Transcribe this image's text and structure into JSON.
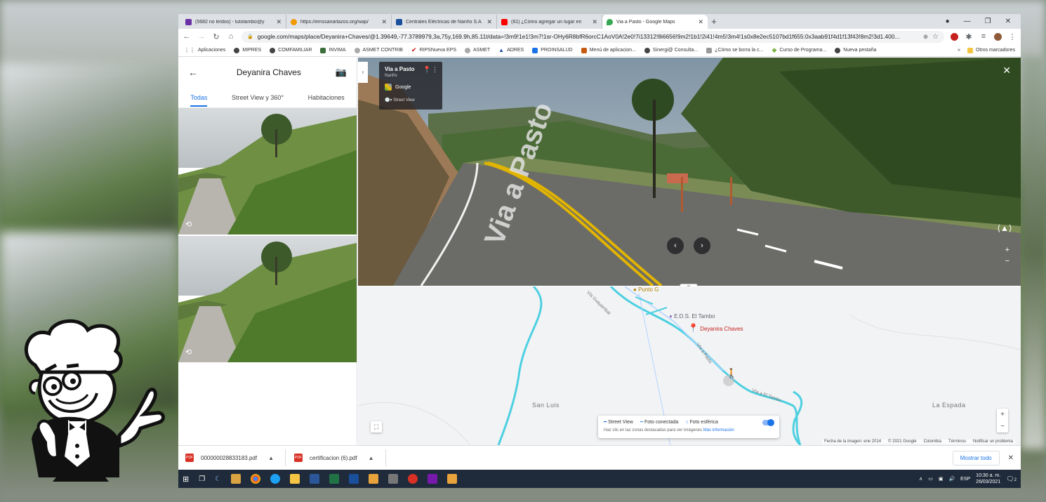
{
  "browser": {
    "tabs": [
      {
        "title": "(5682 no leídos) - tutotambo@y",
        "color": "#6b2fa5"
      },
      {
        "title": "https://emssanarlazos.org/wap/",
        "color": "#f29900"
      },
      {
        "title": "Centrales Eléctricas de Nariño S.A",
        "color": "#1a4f9c"
      },
      {
        "title": "(81) ¿Cómo agregar un lugar en",
        "color": "#ff0000"
      },
      {
        "title": "Via a Pasto - Google Maps",
        "color": "#34a853"
      }
    ],
    "url": "google.com/maps/place/Deyanira+Chaves/@1.39649,-77.3789979,3a,75y,169.9h,85.11t/data=!3m9!1e1!3m7!1sr-OHy6R8bfR6orcC1AoV0A!2e0!7i13312!8i6656!9m2!1b1!2i41!4m5!3m4!1s0x8e2ec5107bd1f655:0x3aab91f4d1f13f43!8m2!3d1.400..."
  },
  "bookmarks": [
    {
      "label": "Aplicaciones",
      "color": "#555"
    },
    {
      "label": "MIPRES",
      "color": "#444"
    },
    {
      "label": "COMFAMILIAR",
      "color": "#444"
    },
    {
      "label": "INVIMA",
      "color": "#3c6e3c"
    },
    {
      "label": "ASMET CONTRIB",
      "color": "#888"
    },
    {
      "label": "RIPSNueva EPS",
      "color": "#c00"
    },
    {
      "label": "ASMET",
      "color": "#888"
    },
    {
      "label": "ADRES",
      "color": "#1a4f9c"
    },
    {
      "label": "PROINSALUD",
      "color": "#1a73e8"
    },
    {
      "label": "Menú de aplicacion...",
      "color": "#c55a11"
    },
    {
      "label": "Sinergi@ Consulta...",
      "color": "#444"
    },
    {
      "label": "¿Cómo se borra la c...",
      "color": "#888"
    },
    {
      "label": "Curso de Programa...",
      "color": "#7cb342"
    },
    {
      "label": "Nueva pestaña",
      "color": "#444"
    }
  ],
  "bookmarks_more": "»",
  "other_bookmarks": "Otros marcadores",
  "panel": {
    "title": "Deyanira Chaves",
    "tabs": [
      "Todas",
      "Street View y 360°",
      "Habitaciones"
    ]
  },
  "streetview": {
    "place": "Via a Pasto",
    "region": "Nariño",
    "provider": "Google",
    "mode": "Street View"
  },
  "map": {
    "labels": {
      "punto": "Punto G",
      "eds": "E.D.S. El Tambo",
      "pin": "Deyanira Chaves",
      "san_luis": "San Luis",
      "la_espada": "La Espada",
      "road1": "Vía a Pasto",
      "road2": "Vía a El Tambo",
      "road3": "Vía Guayambal"
    },
    "legend": {
      "sv": "Street View",
      "foto": "Foto conectada",
      "esferica": "Foto esférica",
      "hint": "Haz clic en las zonas destacadas para ver imágenes",
      "more": "Más información"
    },
    "attribution": [
      "Fecha de la imagen: ene 2014",
      "© 2021 Google",
      "Colombia",
      "Términos",
      "Notificar un problema"
    ]
  },
  "downloads": {
    "files": [
      "000000028833183.pdf",
      "certificacion (6).pdf"
    ],
    "show_all": "Mostrar todo"
  },
  "taskbar": {
    "lang": "ESP",
    "time": "10:30 a. m.",
    "date": "26/03/2021",
    "notif": "2"
  }
}
